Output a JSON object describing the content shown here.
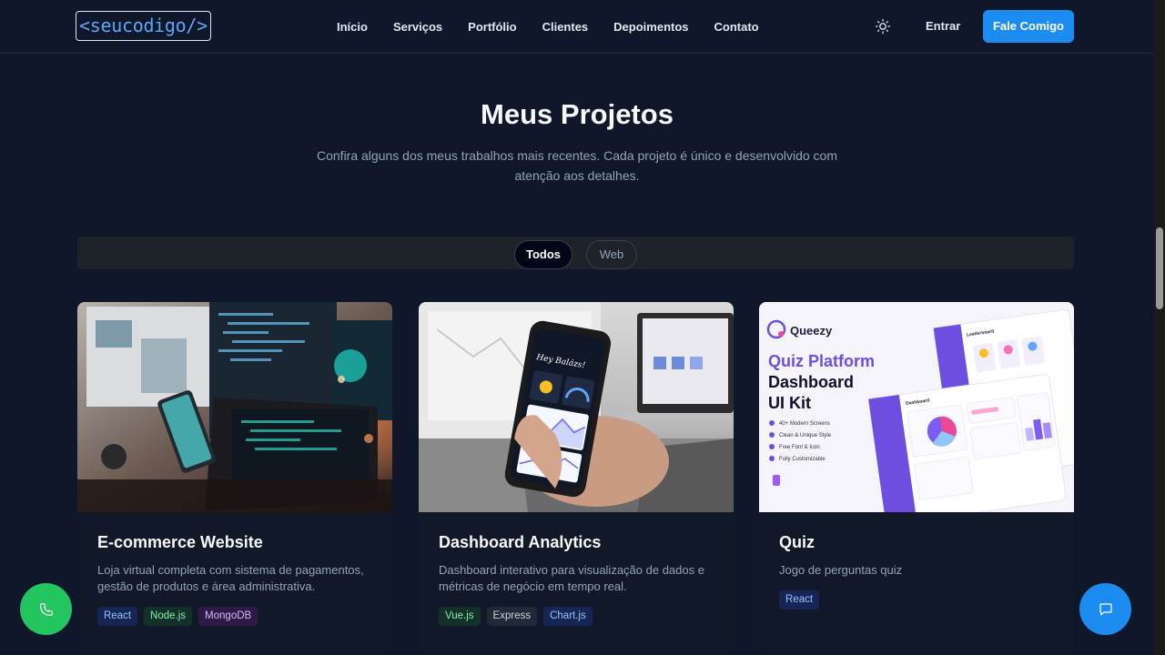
{
  "nav": {
    "logo": "<seucodigo/>",
    "links": [
      "Início",
      "Serviços",
      "Portfólio",
      "Clientes",
      "Depoimentos",
      "Contato"
    ],
    "login": "Entrar",
    "cta": "Fale Comigo"
  },
  "section": {
    "title": "Meus Projetos",
    "subtitle": "Confira alguns dos meus trabalhos mais recentes. Cada projeto é único e desenvolvido com atenção aos detalhes."
  },
  "filters": {
    "active": "Todos",
    "other": "Web"
  },
  "projects": [
    {
      "title": "E-commerce Website",
      "description": "Loja virtual completa com sistema de pagamentos, gestão de produtos e área administrativa.",
      "tags": [
        "React",
        "Node.js",
        "MongoDB"
      ]
    },
    {
      "title": "Dashboard Analytics",
      "description": "Dashboard interativo para visualização de dados e métricas de negócio em tempo real.",
      "tags": [
        "Vue.js",
        "Express",
        "Chart.js"
      ],
      "phone_greeting": "Hey Balázs!"
    },
    {
      "title": "Quiz",
      "description": "Jogo de perguntas quiz",
      "tags": [
        "React"
      ],
      "thumb": {
        "brand": "Queezy",
        "headline_1": "Quiz Platform",
        "headline_2": "Dashboard",
        "headline_3": "UI Kit",
        "features": [
          "40+ Modern Screens",
          "Clean & Unique Style",
          "Free Font & Icon",
          "Fully Customizable"
        ],
        "mock_title": "Leaderboard",
        "mock_section": "Dashboard"
      }
    }
  ],
  "icons": {
    "theme": "sun-icon",
    "phone": "phone-icon",
    "chat": "chat-icon"
  },
  "colors": {
    "background": "#0f172a",
    "accent": "#1d8cf0",
    "whatsapp": "#22c55e",
    "quiz_purple": "#6d4ee0"
  }
}
